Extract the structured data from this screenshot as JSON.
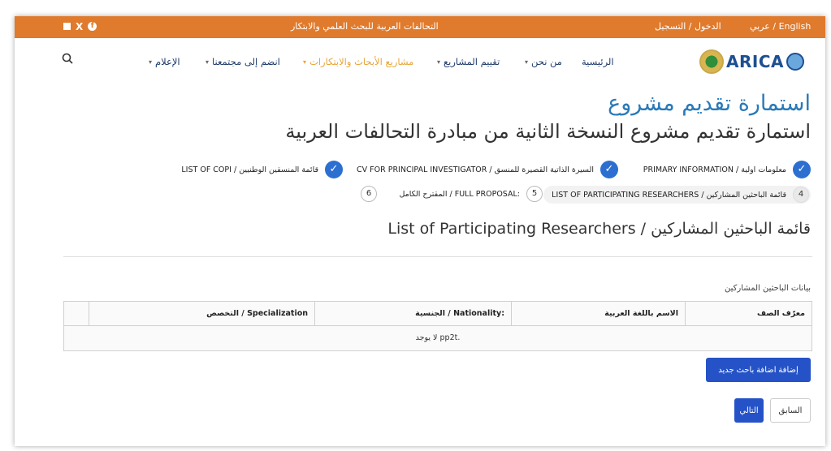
{
  "topbar": {
    "title": "التحالفات العربية للبحث العلمي والابتكار",
    "login": "الدخول / التسجيل",
    "lang": "عربي / English",
    "social_icons": [
      "square-icon",
      "x-icon",
      "facebook-icon"
    ]
  },
  "nav": {
    "logo_text": "ARICA",
    "items": [
      {
        "label": "الرئيسية"
      },
      {
        "label": "من نحن"
      },
      {
        "label": "تقييم المشاريع"
      },
      {
        "label": "مشاريع الأبحاث والابتكارات"
      },
      {
        "label": "انضم إلى مجتمعنا"
      },
      {
        "label": "الإعلام"
      }
    ]
  },
  "page": {
    "title": "استمارة تقديم مشروع",
    "subtitle": "استمارة تقديم مشروع النسخة الثانية من مبادرة التحالفات العربية"
  },
  "steps": [
    {
      "label": "PRIMARY INFORMATION / معلومات اولية",
      "state": "done"
    },
    {
      "label": "CV FOR PRINCIPAL INVESTIGATOR / السيرة الذاتية القصيرة للمنسق",
      "state": "done"
    },
    {
      "label": "LIST OF COPI / قائمة المنسقين الوطنيين",
      "state": "done"
    },
    {
      "label": "LIST OF PARTICIPATING RESEARCHERS / قائمة الباحثين المشاركين",
      "num": "4",
      "state": "current"
    },
    {
      "label": "المقترح الكامل / FULL PROPOSAL:",
      "num": "5",
      "state": "todo"
    },
    {
      "num": "6",
      "state": "todo"
    }
  ],
  "section": {
    "title": "List of Participating Researchers / قائمة الباحثين المشاركين"
  },
  "table": {
    "caption": "بيانات الباحثين المشاركين",
    "columns": [
      "معرّف الصف",
      "الاسم باللغة العربية",
      "الجنسية / Nationality:",
      "التخصص / Specialization",
      ""
    ],
    "empty_text": "لا يوجد pp2t."
  },
  "buttons": {
    "add": "إضافة اضافة باحث جديد",
    "prev": "السابق",
    "next": "التالي"
  },
  "colors": {
    "topbar": "#e07a2c",
    "accent": "#2553c7",
    "title": "#2a7ab8",
    "active_menu": "#e8a53a"
  }
}
